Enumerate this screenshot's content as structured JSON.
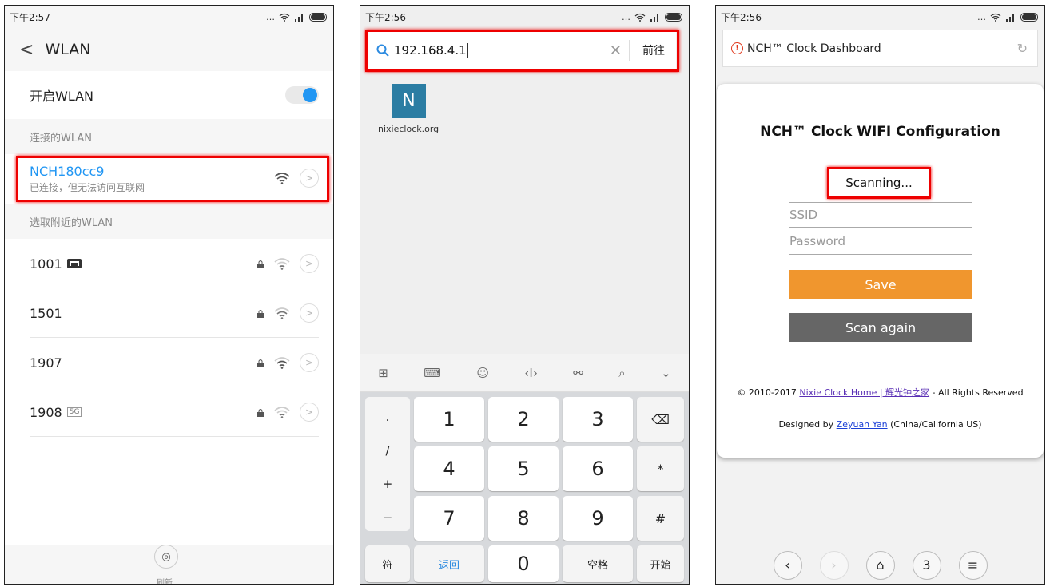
{
  "phone1": {
    "status_time": "下午2:57",
    "title": "WLAN",
    "toggle_label": "开启WLAN",
    "connected_header": "连接的WLAN",
    "connected": {
      "ssid": "NCH180cc9",
      "status": "已连接，但无法访问互联网"
    },
    "nearby_header": "选取附近的WLAN",
    "networks": [
      {
        "ssid": "1001",
        "badge": "mi"
      },
      {
        "ssid": "1501",
        "badge": ""
      },
      {
        "ssid": "1907",
        "badge": ""
      },
      {
        "ssid": "1908",
        "badge": "5G"
      }
    ],
    "refresh_label": "刷新"
  },
  "phone2": {
    "status_time": "下午2:56",
    "url": "192.168.4.1",
    "go_label": "前往",
    "tile_letter": "N",
    "tile_label": "nixieclock.org",
    "keys": {
      "sym1": ".",
      "sym2": "/",
      "sym3": "+",
      "sym4": "−",
      "k1": "1",
      "k2": "2",
      "k3": "3",
      "k4": "4",
      "k5": "5",
      "k6": "6",
      "k7": "7",
      "k8": "8",
      "k9": "9",
      "k0": "0",
      "star": "*",
      "hash": "#",
      "fu": "符",
      "back": "返回",
      "space": "空格",
      "start": "开始"
    }
  },
  "phone3": {
    "status_time": "下午2:56",
    "tab_title": "NCH™ Clock Dashboard",
    "card_title": "NCH™ Clock WIFI Configuration",
    "scanning": "Scanning...",
    "ssid_placeholder": "SSID",
    "password_placeholder": "Password",
    "save_label": "Save",
    "scan_again_label": "Scan again",
    "footer_prefix": "© 2010-2017 ",
    "footer_link": "Nixie Clock Home | 辉光钟之家",
    "footer_suffix": " - All Rights Reserved",
    "designed_prefix": "Designed by ",
    "designed_link": "Zeyuan Yan",
    "designed_suffix": " (China/California US)",
    "tab_count": "3"
  },
  "colors": {
    "accent_blue": "#2196f3",
    "highlight_red": "#e00000",
    "save_orange": "#f0962e",
    "scan_gray": "#666666"
  }
}
